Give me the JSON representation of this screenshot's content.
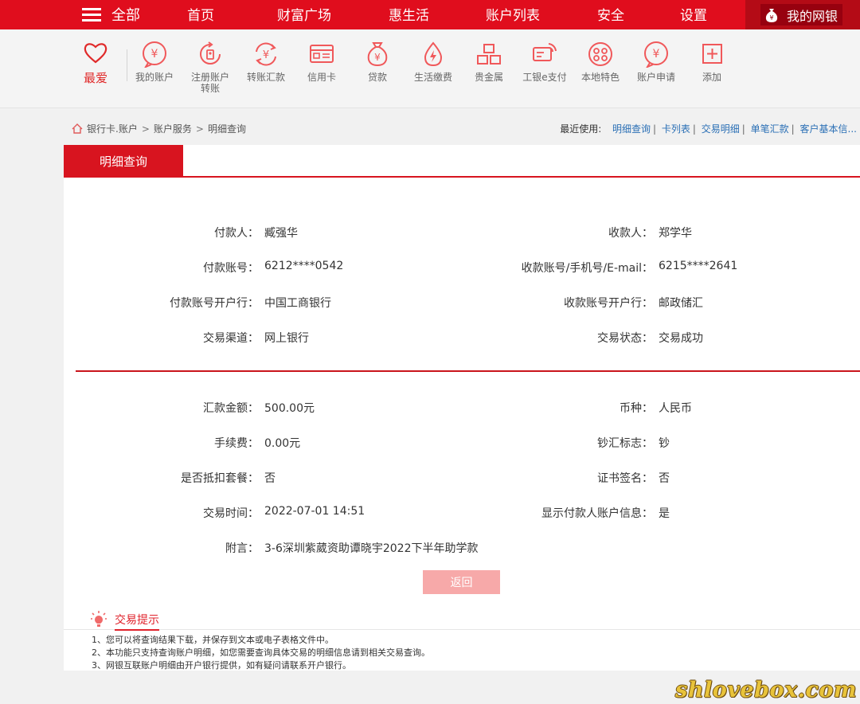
{
  "colors": {
    "brand_red": "#e00d1d",
    "dark_red": "#b40b16",
    "link_blue": "#2a6fb5",
    "disabled_button": "#f7a9a9"
  },
  "topnav": {
    "menu_label": "全部",
    "items": [
      "首页",
      "财富广场",
      "惠生活",
      "账户列表",
      "安全",
      "设置"
    ],
    "mybank_label": "我的网银"
  },
  "shortcuts": {
    "favorite_label": "最爱",
    "items": [
      {
        "label": "我的账户",
        "icon": "yuan-coin-icon"
      },
      {
        "label": "注册账户转账",
        "icon": "register-transfer-icon"
      },
      {
        "label": "转账汇款",
        "icon": "transfer-icon"
      },
      {
        "label": "信用卡",
        "icon": "credit-card-icon"
      },
      {
        "label": "贷款",
        "icon": "loan-bag-icon"
      },
      {
        "label": "生活缴费",
        "icon": "utility-drop-icon"
      },
      {
        "label": "贵金属",
        "icon": "gold-bars-icon"
      },
      {
        "label": "工银e支付",
        "icon": "epay-icon"
      },
      {
        "label": "本地特色",
        "icon": "local-feature-icon"
      },
      {
        "label": "账户申请",
        "icon": "account-apply-icon"
      },
      {
        "label": "添加",
        "icon": "add-icon"
      }
    ]
  },
  "breadcrumb": {
    "items": [
      "银行卡.账户",
      "账户服务",
      "明细查询"
    ],
    "separator": ">"
  },
  "recent": {
    "label": "最近使用:",
    "links": [
      "明细查询",
      "卡列表",
      "交易明细",
      "单笔汇款",
      "客户基本信..."
    ]
  },
  "tab": {
    "active_label": "明细查询"
  },
  "details": {
    "payer_label": "付款人：",
    "payer": "臧强华",
    "payee_label": "收款人：",
    "payee": "郑学华",
    "payer_account_label": "付款账号：",
    "payer_account": "6212****0542",
    "payee_account_label": "收款账号/手机号/E-mail：",
    "payee_account": "6215****2641",
    "payer_bank_label": "付款账号开户行：",
    "payer_bank": "中国工商银行",
    "payee_bank_label": "收款账号开户行：",
    "payee_bank": "邮政储汇",
    "channel_label": "交易渠道：",
    "channel": "网上银行",
    "status_label": "交易状态：",
    "status": "交易成功",
    "amount_label": "汇款金额：",
    "amount": "500.00元",
    "currency_label": "币种：",
    "currency": "人民币",
    "fee_label": "手续费：",
    "fee": "0.00元",
    "cash_flag_label": "钞汇标志：",
    "cash_flag": "钞",
    "package_label": "是否抵扣套餐：",
    "package": "否",
    "cert_label": "证书签名：",
    "cert": "否",
    "time_label": "交易时间：",
    "time": "2022-07-01 14:51",
    "show_payer_label": "显示付款人账户信息：",
    "show_payer": "是",
    "memo_label": "附言：",
    "memo": "3-6深圳紫葳资助谭晓宇2022下半年助学款"
  },
  "back_button": "返回",
  "tips": {
    "title": "交易提示",
    "items": [
      "1、您可以将查询结果下载，并保存到文本或电子表格文件中。",
      "2、本功能只支持查询账户明细，如您需要查询具体交易的明细信息请到相关交易查询。",
      "3、网银互联账户明细由开户银行提供，如有疑问请联系开户银行。"
    ]
  },
  "watermark": "shlovebox.com"
}
